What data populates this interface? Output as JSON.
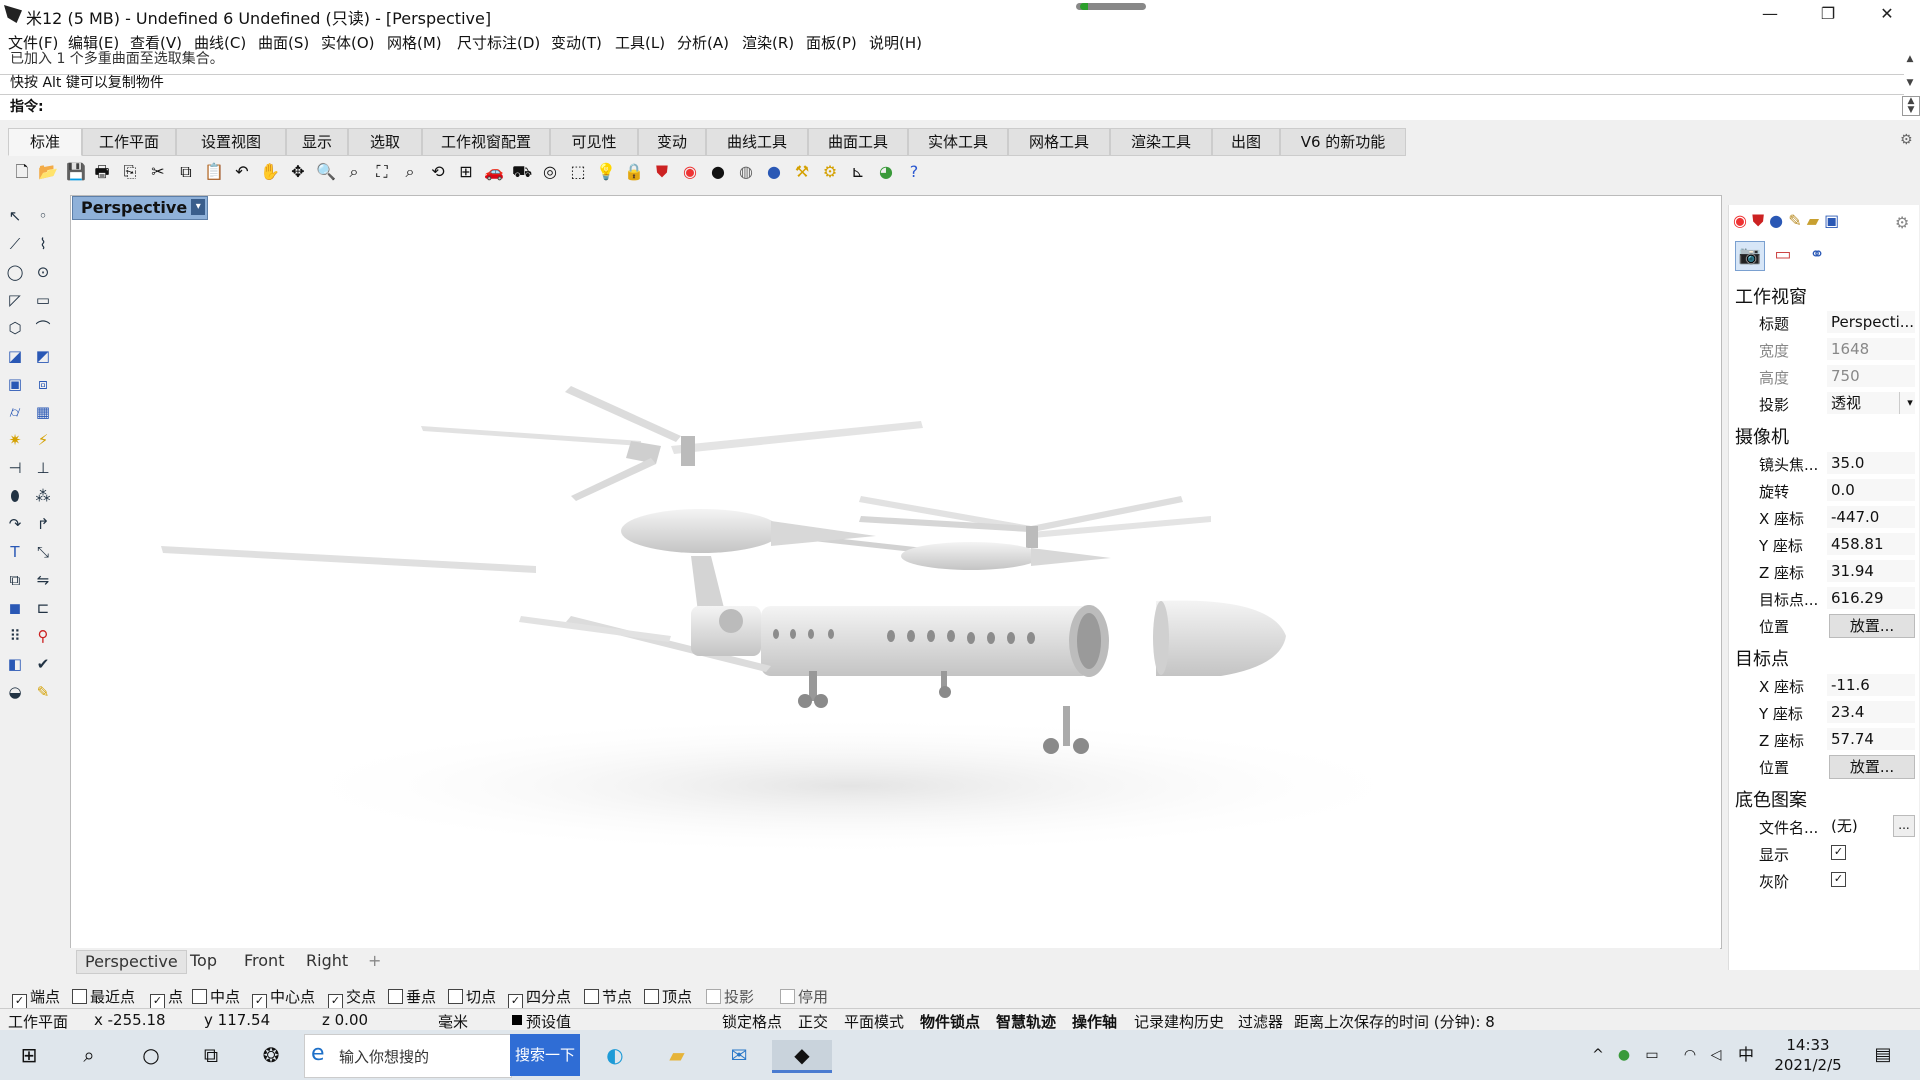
{
  "window": {
    "title": "米12 (5 MB) - Undefined 6 Undefined (只读) - [Perspective]",
    "minimize": "—",
    "restore": "❐",
    "close": "✕"
  },
  "menu": [
    "文件(F)",
    "编辑(E)",
    "查看(V)",
    "曲线(C)",
    "曲面(S)",
    "实体(O)",
    "网格(M)",
    "尺寸标注(D)",
    "变动(T)",
    "工具(L)",
    "分析(A)",
    "渲染(R)",
    "面板(P)",
    "说明(H)"
  ],
  "command": {
    "history_1": "已加入 1 个多重曲面至选取集合。",
    "history_2": "快按 Alt 键可以复制物件",
    "prompt_label": "指令:"
  },
  "tabs": [
    "标准",
    "工作平面",
    "设置视图",
    "显示",
    "选取",
    "工作视窗配置",
    "可见性",
    "变动",
    "曲线工具",
    "曲面工具",
    "实体工具",
    "网格工具",
    "渲染工具",
    "出图",
    "V6 的新功能"
  ],
  "active_tab": "标准",
  "viewport": {
    "label": "Perspective",
    "tabs": [
      "Perspective",
      "Top",
      "Front",
      "Right"
    ],
    "add_tab": "+"
  },
  "panel": {
    "section_viewport": "工作视窗",
    "title_label": "标题",
    "title_value": "Perspecti...",
    "width_label": "宽度",
    "width_value": "1648",
    "height_label": "高度",
    "height_value": "750",
    "projection_label": "投影",
    "projection_value": "透视",
    "section_camera": "摄像机",
    "focal_label": "镜头焦...",
    "focal_value": "35.0",
    "rotate_label": "旋转",
    "rotate_value": "0.0",
    "cx_label": "X 座标",
    "cx_value": "-447.0",
    "cy_label": "Y 座标",
    "cy_value": "458.81",
    "cz_label": "Z 座标",
    "cz_value": "31.94",
    "target_dist_label": "目标点...",
    "target_dist_value": "616.29",
    "position_label": "位置",
    "place_button": "放置...",
    "section_target": "目标点",
    "tx_label": "X 座标",
    "tx_value": "-11.6",
    "ty_label": "Y 座标",
    "ty_value": "23.4",
    "tz_label": "Z 座标",
    "tz_value": "57.74",
    "section_wallpaper": "底色图案",
    "file_label": "文件名...",
    "file_value": "(无)",
    "browse": "...",
    "show_label": "显示",
    "gray_label": "灰阶"
  },
  "osnap": [
    {
      "label": "端点",
      "checked": true
    },
    {
      "label": "最近点",
      "checked": false
    },
    {
      "label": "点",
      "checked": true
    },
    {
      "label": "中点",
      "checked": false
    },
    {
      "label": "中心点",
      "checked": true
    },
    {
      "label": "交点",
      "checked": true
    },
    {
      "label": "垂点",
      "checked": false
    },
    {
      "label": "切点",
      "checked": false
    },
    {
      "label": "四分点",
      "checked": true
    },
    {
      "label": "节点",
      "checked": false
    },
    {
      "label": "顶点",
      "checked": false
    },
    {
      "label": "投影",
      "checked": false
    },
    {
      "label": "停用",
      "checked": false
    }
  ],
  "status": {
    "cplane": "工作平面",
    "x": "x -255.18",
    "y": "y 117.54",
    "z": "z 0.00",
    "units": "毫米",
    "layer": "预设值",
    "grid_snap": "锁定格点",
    "ortho": "正交",
    "planar": "平面模式",
    "osnap": "物件锁点",
    "smarttrack": "智慧轨迹",
    "gumball": "操作轴",
    "history": "记录建构历史",
    "filter": "过滤器",
    "autosave": "距离上次保存的时间 (分钟): 8"
  },
  "taskbar": {
    "search_placeholder": "输入你想搜的",
    "search_button": "搜索一下",
    "ime": "中",
    "time": "14:33",
    "date": "2021/2/5"
  },
  "colors": {
    "viewport_label_bg": "#8fb1d9",
    "taskbar_bg": "#dfe6ec",
    "search_button_bg": "#2f6dd5"
  }
}
